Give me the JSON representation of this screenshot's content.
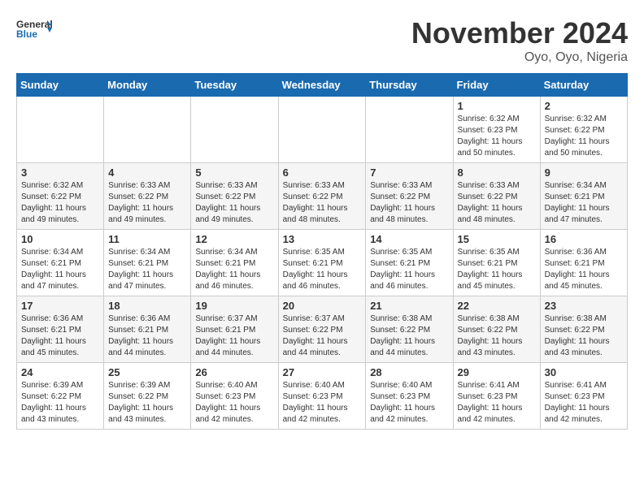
{
  "header": {
    "logo_general": "General",
    "logo_blue": "Blue",
    "month_title": "November 2024",
    "location": "Oyo, Oyo, Nigeria"
  },
  "weekdays": [
    "Sunday",
    "Monday",
    "Tuesday",
    "Wednesday",
    "Thursday",
    "Friday",
    "Saturday"
  ],
  "weeks": [
    [
      {
        "day": "",
        "info": ""
      },
      {
        "day": "",
        "info": ""
      },
      {
        "day": "",
        "info": ""
      },
      {
        "day": "",
        "info": ""
      },
      {
        "day": "",
        "info": ""
      },
      {
        "day": "1",
        "info": "Sunrise: 6:32 AM\nSunset: 6:23 PM\nDaylight: 11 hours and 50 minutes."
      },
      {
        "day": "2",
        "info": "Sunrise: 6:32 AM\nSunset: 6:22 PM\nDaylight: 11 hours and 50 minutes."
      }
    ],
    [
      {
        "day": "3",
        "info": "Sunrise: 6:32 AM\nSunset: 6:22 PM\nDaylight: 11 hours and 49 minutes."
      },
      {
        "day": "4",
        "info": "Sunrise: 6:33 AM\nSunset: 6:22 PM\nDaylight: 11 hours and 49 minutes."
      },
      {
        "day": "5",
        "info": "Sunrise: 6:33 AM\nSunset: 6:22 PM\nDaylight: 11 hours and 49 minutes."
      },
      {
        "day": "6",
        "info": "Sunrise: 6:33 AM\nSunset: 6:22 PM\nDaylight: 11 hours and 48 minutes."
      },
      {
        "day": "7",
        "info": "Sunrise: 6:33 AM\nSunset: 6:22 PM\nDaylight: 11 hours and 48 minutes."
      },
      {
        "day": "8",
        "info": "Sunrise: 6:33 AM\nSunset: 6:22 PM\nDaylight: 11 hours and 48 minutes."
      },
      {
        "day": "9",
        "info": "Sunrise: 6:34 AM\nSunset: 6:21 PM\nDaylight: 11 hours and 47 minutes."
      }
    ],
    [
      {
        "day": "10",
        "info": "Sunrise: 6:34 AM\nSunset: 6:21 PM\nDaylight: 11 hours and 47 minutes."
      },
      {
        "day": "11",
        "info": "Sunrise: 6:34 AM\nSunset: 6:21 PM\nDaylight: 11 hours and 47 minutes."
      },
      {
        "day": "12",
        "info": "Sunrise: 6:34 AM\nSunset: 6:21 PM\nDaylight: 11 hours and 46 minutes."
      },
      {
        "day": "13",
        "info": "Sunrise: 6:35 AM\nSunset: 6:21 PM\nDaylight: 11 hours and 46 minutes."
      },
      {
        "day": "14",
        "info": "Sunrise: 6:35 AM\nSunset: 6:21 PM\nDaylight: 11 hours and 46 minutes."
      },
      {
        "day": "15",
        "info": "Sunrise: 6:35 AM\nSunset: 6:21 PM\nDaylight: 11 hours and 45 minutes."
      },
      {
        "day": "16",
        "info": "Sunrise: 6:36 AM\nSunset: 6:21 PM\nDaylight: 11 hours and 45 minutes."
      }
    ],
    [
      {
        "day": "17",
        "info": "Sunrise: 6:36 AM\nSunset: 6:21 PM\nDaylight: 11 hours and 45 minutes."
      },
      {
        "day": "18",
        "info": "Sunrise: 6:36 AM\nSunset: 6:21 PM\nDaylight: 11 hours and 44 minutes."
      },
      {
        "day": "19",
        "info": "Sunrise: 6:37 AM\nSunset: 6:21 PM\nDaylight: 11 hours and 44 minutes."
      },
      {
        "day": "20",
        "info": "Sunrise: 6:37 AM\nSunset: 6:22 PM\nDaylight: 11 hours and 44 minutes."
      },
      {
        "day": "21",
        "info": "Sunrise: 6:38 AM\nSunset: 6:22 PM\nDaylight: 11 hours and 44 minutes."
      },
      {
        "day": "22",
        "info": "Sunrise: 6:38 AM\nSunset: 6:22 PM\nDaylight: 11 hours and 43 minutes."
      },
      {
        "day": "23",
        "info": "Sunrise: 6:38 AM\nSunset: 6:22 PM\nDaylight: 11 hours and 43 minutes."
      }
    ],
    [
      {
        "day": "24",
        "info": "Sunrise: 6:39 AM\nSunset: 6:22 PM\nDaylight: 11 hours and 43 minutes."
      },
      {
        "day": "25",
        "info": "Sunrise: 6:39 AM\nSunset: 6:22 PM\nDaylight: 11 hours and 43 minutes."
      },
      {
        "day": "26",
        "info": "Sunrise: 6:40 AM\nSunset: 6:23 PM\nDaylight: 11 hours and 42 minutes."
      },
      {
        "day": "27",
        "info": "Sunrise: 6:40 AM\nSunset: 6:23 PM\nDaylight: 11 hours and 42 minutes."
      },
      {
        "day": "28",
        "info": "Sunrise: 6:40 AM\nSunset: 6:23 PM\nDaylight: 11 hours and 42 minutes."
      },
      {
        "day": "29",
        "info": "Sunrise: 6:41 AM\nSunset: 6:23 PM\nDaylight: 11 hours and 42 minutes."
      },
      {
        "day": "30",
        "info": "Sunrise: 6:41 AM\nSunset: 6:23 PM\nDaylight: 11 hours and 42 minutes."
      }
    ]
  ]
}
